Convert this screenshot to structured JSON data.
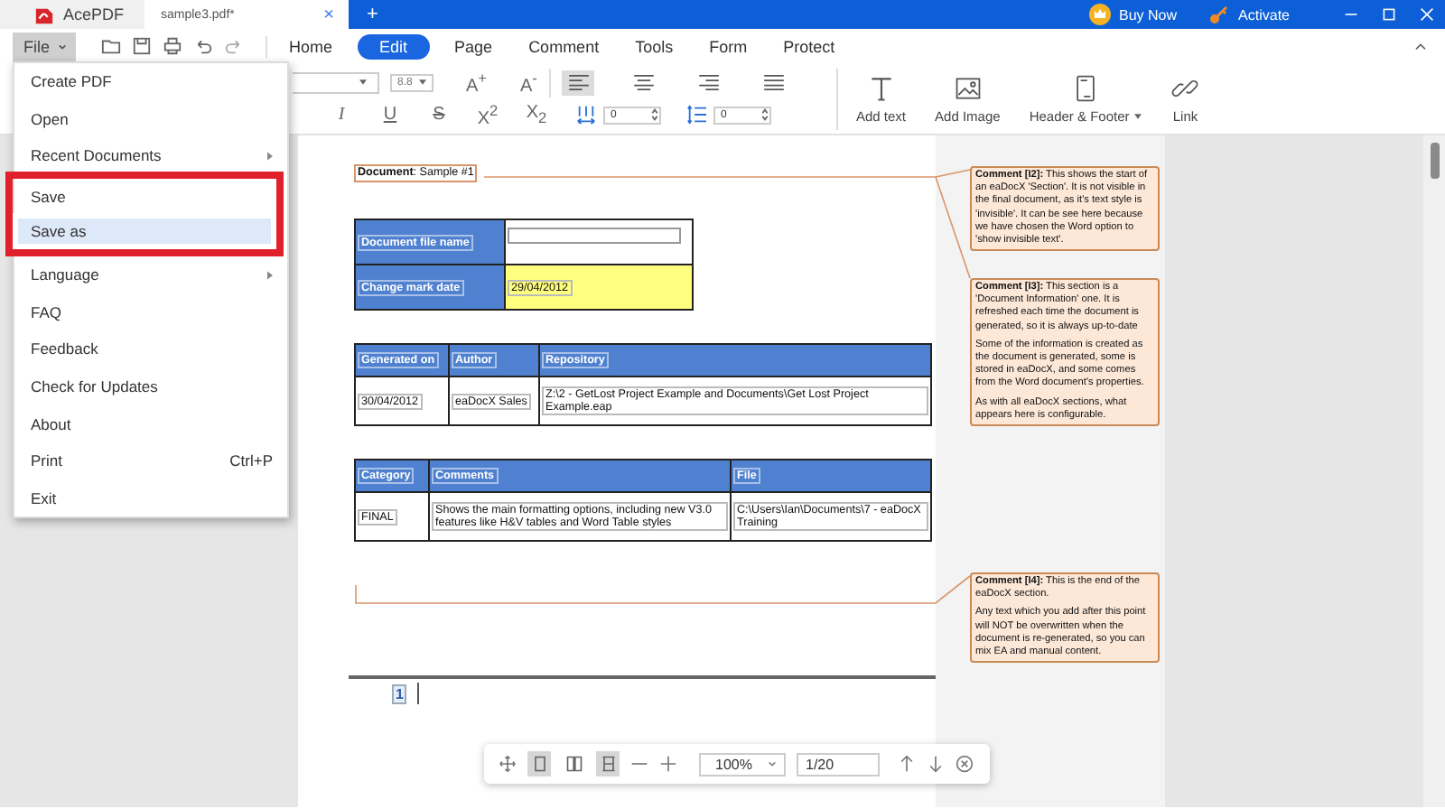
{
  "app": {
    "name": "AcePDF"
  },
  "document_tab": {
    "title": "sample3.pdf*",
    "close": "×"
  },
  "new_tab": "+",
  "header_actions": [
    {
      "label": "Buy Now",
      "kind": "crown"
    },
    {
      "label": "Activate",
      "kind": "key"
    }
  ],
  "menu_button": {
    "label": "File"
  },
  "nav_tabs": [
    {
      "label": "Home",
      "selected": false
    },
    {
      "label": "Edit",
      "selected": true
    },
    {
      "label": "Page",
      "selected": false
    },
    {
      "label": "Comment",
      "selected": false
    },
    {
      "label": "Tools",
      "selected": false
    },
    {
      "label": "Form",
      "selected": false
    },
    {
      "label": "Protect",
      "selected": false
    }
  ],
  "ribbon": {
    "font_size": "8.8",
    "font_buttons": [
      "A$^{+}$",
      "A$^{-}$"
    ],
    "alignments": [
      {
        "kind": "left",
        "selected": true
      },
      {
        "kind": "center",
        "selected": false
      },
      {
        "kind": "right",
        "selected": false
      },
      {
        "kind": "justify",
        "selected": false
      }
    ],
    "format_buttons": [
      "I",
      "U",
      "S",
      "X$^{2}$",
      "X$_{2}$"
    ],
    "char_spacing": "0",
    "line_spacing": "0",
    "tools": [
      {
        "label": "Add text",
        "kind": "text",
        "dropdown": false
      },
      {
        "label": "Add Image",
        "kind": "image",
        "dropdown": false
      },
      {
        "label": "Header & Footer",
        "kind": "page",
        "dropdown": true
      },
      {
        "label": "Link",
        "kind": "link",
        "dropdown": false
      }
    ]
  },
  "file_menu": {
    "items": [
      {
        "label": "Create PDF",
        "submenu": false,
        "selected": false,
        "outlined": false
      },
      {
        "label": "Open",
        "submenu": false,
        "selected": false,
        "outlined": false
      },
      {
        "label": "Recent Documents",
        "submenu": true,
        "selected": false,
        "outlined": false
      },
      {
        "label": "Save",
        "submenu": false,
        "selected": false,
        "outlined": true
      },
      {
        "label": "Save as",
        "submenu": false,
        "selected": true,
        "outlined": true
      },
      {
        "label": "Language",
        "submenu": true,
        "selected": false,
        "outlined": false
      },
      {
        "label": "FAQ",
        "submenu": false,
        "selected": false,
        "outlined": false
      },
      {
        "label": "Feedback",
        "submenu": false,
        "selected": false,
        "outlined": false
      },
      {
        "label": "Check for Updates",
        "submenu": false,
        "selected": false,
        "outlined": false
      },
      {
        "label": "About",
        "submenu": false,
        "selected": false,
        "outlined": false
      },
      {
        "label": "Print",
        "submenu": false,
        "selected": false,
        "outlined": false,
        "shortcut": "Ctrl+P"
      },
      {
        "label": "Exit",
        "submenu": false,
        "selected": false,
        "outlined": false
      }
    ]
  },
  "document": {
    "heading": "**Document**: Sample #1",
    "info_table": [
      {
        "label": "Document file name",
        "kind": "field"
      },
      {
        "label": "Change mark date",
        "kind": "highlight",
        "value": "29/04/2012"
      }
    ],
    "generation_table": {
      "columns": [
        "Generated on",
        "Author",
        "Repository"
      ],
      "rows": [
        [
          "30/04/2012",
          "eaDocX Sales",
          "Z:\\2 - GetLost Project Example and Documents\\Get Lost Project Example.eap"
        ]
      ]
    },
    "status_table": {
      "columns": [
        "Category",
        "Comments",
        "File"
      ],
      "rows": [
        [
          "FINAL",
          "Shows the main formatting options, including new V3.0 features like H&V tables and Word Table styles",
          "C:\\Users\\Ian\\Documents\\7 - eaDocX Training"
        ]
      ]
    },
    "page_number": "1"
  },
  "comments": [
    {
      "paragraphs": [
        "**Comment [I2]:** This shows the start of an eaDocX 'Section'. It is not visible in the final document, as it's text style is 'invisible'. It can be see here because we have chosen the Word option to 'show invisible text'."
      ]
    },
    {
      "paragraphs": [
        "**Comment [I3]:** This section is a 'Document Information' one. It is refreshed each time the document is generated, so it is always up-to-date",
        "Some of the information is created as the document is generated, some is stored in eaDocX, and some comes from the Word document's properties.",
        "As with all eaDocX sections, what appears here is configurable."
      ]
    },
    {
      "paragraphs": [
        "**Comment [I4]:** This is the end of the eaDocX section.",
        "Any text which you add after this point will NOT be overwritten when the document is re-generated, so you can mix EA and manual content."
      ]
    }
  ],
  "view_toolbar": {
    "view_buttons": [
      {
        "kind": "single",
        "selected": true
      },
      {
        "kind": "double",
        "selected": false
      },
      {
        "kind": "fit",
        "selected": true
      }
    ],
    "zoom": "100%",
    "page": "1/20"
  }
}
